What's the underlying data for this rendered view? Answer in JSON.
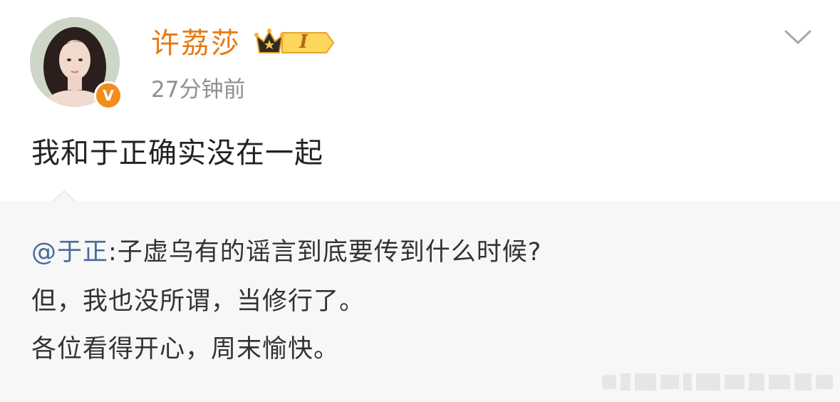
{
  "post": {
    "author": {
      "name": "许荔莎",
      "level_badge": "I",
      "verified_mark": "V",
      "avatar_icon": "user-avatar-icon"
    },
    "timestamp": "27分钟前",
    "text": "我和于正确实没在一起",
    "menu_icon": "chevron-down-icon"
  },
  "repost": {
    "mention": "@于正",
    "lines": [
      ":子虚乌有的谣言到底要传到什么时候?",
      "但，我也没所谓，当修行了。",
      "各位看得开心，周末愉快。"
    ]
  },
  "colors": {
    "username": "#e8790f",
    "mention": "#4a6a9b",
    "verified": "#f28d1e",
    "repost_bg": "#f7f7f7"
  }
}
